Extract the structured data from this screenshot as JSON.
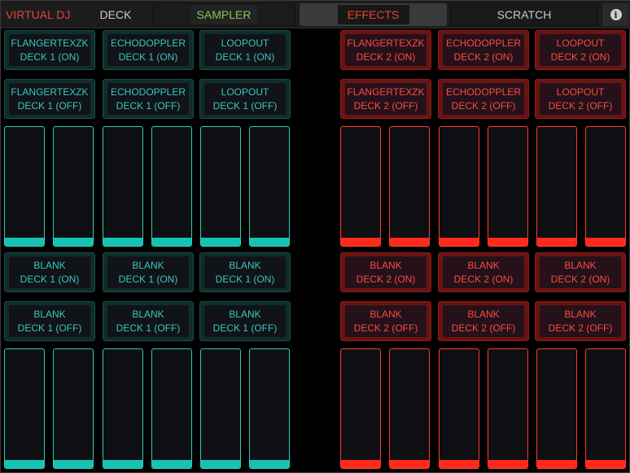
{
  "nav": {
    "brand": "VIRTUAL DJ",
    "deck": "DECK",
    "sampler": "SAMPLER",
    "effects": "EFFECTS",
    "scratch": "SCRATCH",
    "info_icon": "info-icon"
  },
  "colors": {
    "deck1_accent": "#2ecbbe",
    "deck2_accent": "#ff3b2f",
    "brand": "#e8413a",
    "sampler_text": "#86c556"
  },
  "top_effects": {
    "deck1_on": [
      {
        "name": "FLANGERTEXZK",
        "deck": "DECK 1 (ON)"
      },
      {
        "name": "ECHODOPPLER",
        "deck": "DECK 1 (ON)"
      },
      {
        "name": "LOOPOUT",
        "deck": "DECK 1 (ON)"
      }
    ],
    "deck1_off": [
      {
        "name": "FLANGERTEXZK",
        "deck": "DECK 1 (OFF)"
      },
      {
        "name": "ECHODOPPLER",
        "deck": "DECK 1 (OFF)"
      },
      {
        "name": "LOOPOUT",
        "deck": "DECK 1 (OFF)"
      }
    ],
    "deck2_on": [
      {
        "name": "FLANGERTEXZK",
        "deck": "DECK 2 (ON)"
      },
      {
        "name": "ECHODOPPLER",
        "deck": "DECK 2 (ON)"
      },
      {
        "name": "LOOPOUT",
        "deck": "DECK 2 (ON)"
      }
    ],
    "deck2_off": [
      {
        "name": "FLANGERTEXZK",
        "deck": "DECK 2 (OFF)"
      },
      {
        "name": "ECHODOPPLER",
        "deck": "DECK 2 (OFF)"
      },
      {
        "name": "LOOPOUT",
        "deck": "DECK 2 (OFF)"
      }
    ]
  },
  "bottom_effects": {
    "deck1_on": [
      {
        "name": "BLANK",
        "deck": "DECK 1 (ON)"
      },
      {
        "name": "BLANK",
        "deck": "DECK 1 (ON)"
      },
      {
        "name": "BLANK",
        "deck": "DECK 1 (ON)"
      }
    ],
    "deck1_off": [
      {
        "name": "BLANK",
        "deck": "DECK 1 (OFF)"
      },
      {
        "name": "BLANK",
        "deck": "DECK 1 (OFF)"
      },
      {
        "name": "BLANK",
        "deck": "DECK 1 (OFF)"
      }
    ],
    "deck2_on": [
      {
        "name": "BLANK",
        "deck": "DECK 2 (ON)"
      },
      {
        "name": "BLANK",
        "deck": "DECK 2 (ON)"
      },
      {
        "name": "BLANK",
        "deck": "DECK 2 (ON)"
      }
    ],
    "deck2_off": [
      {
        "name": "BLANK",
        "deck": "DECK 2 (OFF)"
      },
      {
        "name": "BLANK",
        "deck": "DECK 2 (OFF)"
      },
      {
        "name": "BLANK",
        "deck": "DECK 2 (OFF)"
      }
    ]
  },
  "slider_levels": {
    "top_deck1": [
      0.07,
      0.07,
      0.07,
      0.07,
      0.07,
      0.07
    ],
    "top_deck2": [
      0.07,
      0.07,
      0.07,
      0.07,
      0.07,
      0.07
    ],
    "bottom_deck1": [
      0.07,
      0.07,
      0.07,
      0.07,
      0.07,
      0.07
    ],
    "bottom_deck2": [
      0.07,
      0.07,
      0.07,
      0.07,
      0.07,
      0.07
    ]
  }
}
